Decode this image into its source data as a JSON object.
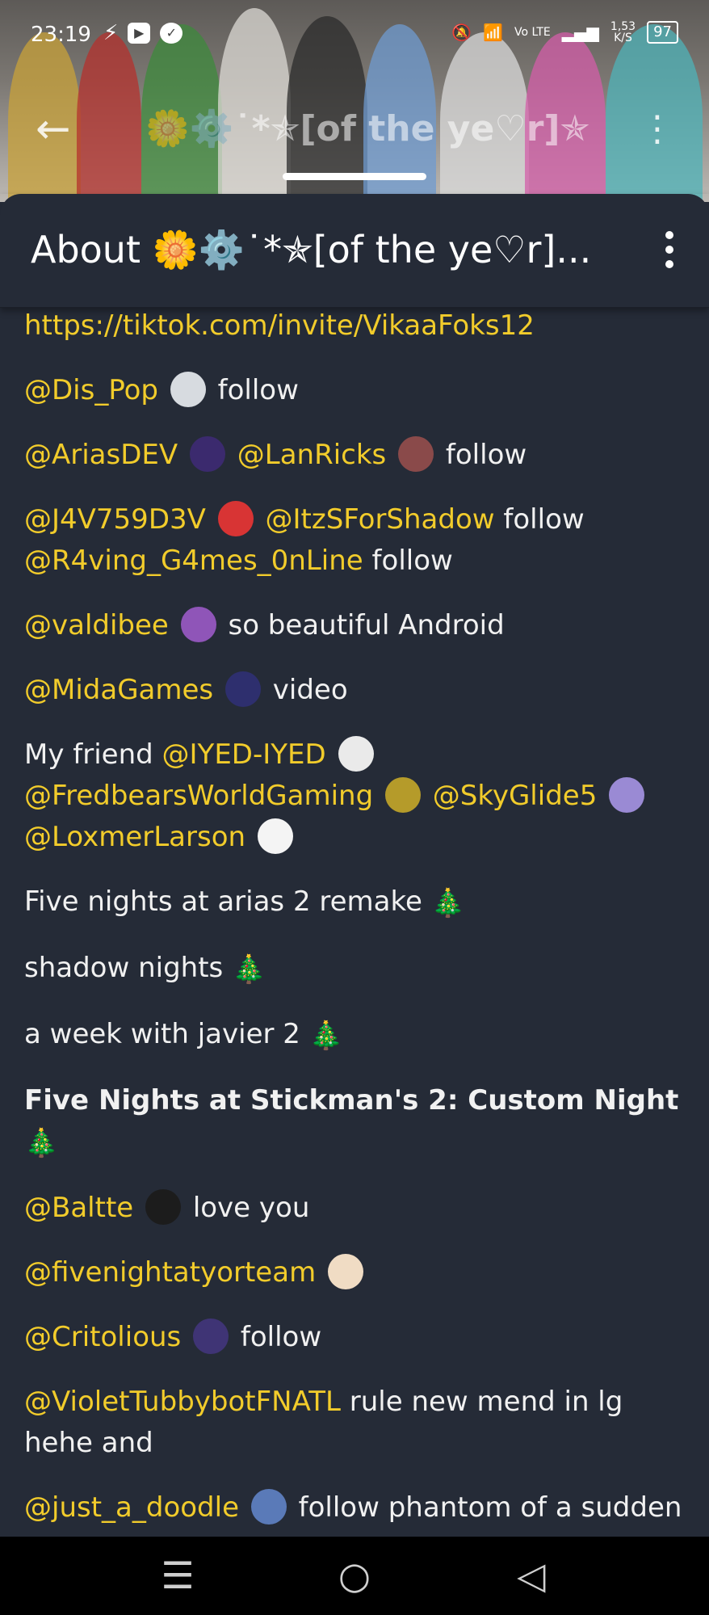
{
  "status_bar": {
    "time": "23:19",
    "network_speed_value": "1,53",
    "network_speed_unit": "K/S",
    "network_type": "Vo LTE",
    "battery": "97"
  },
  "banner": {
    "title": "🌼⚙️˙*✯[of the ye♡r]✯"
  },
  "sheet": {
    "title": "About 🌼⚙️˙*✯[of the ye♡r]..."
  },
  "content": {
    "link": "https://tiktok.com/invite/VikaaFoks12",
    "p1_mention": "@Dis_Pop",
    "p1_text": "follow",
    "p2_mention1": "@AriasDEV",
    "p2_mention2": "@LanRicks",
    "p2_text": "follow",
    "p3_mention1": "@J4V759D3V",
    "p3_mention2": "@ItzSForShadow",
    "p3_text1": "follow",
    "p3_mention3": "@R4ving_G4mes_0nLine",
    "p3_text2": "follow",
    "p4_mention": "@valdibee",
    "p4_text": "so beautiful Android",
    "p5_mention": "@MidaGames",
    "p5_text": "video",
    "p6_text": "My friend",
    "p6_mention1": "@IYED-IYED",
    "p6_mention2": "@FredbearsWorldGaming",
    "p6_mention3": "@SkyGlide5",
    "p6_mention4": "@LoxmerLarson",
    "p7_text": "Five nights at arias 2 remake",
    "p8_text": "shadow nights",
    "p9_text": "a week with javier 2",
    "p10_text": "Five Nights at Stickman's 2: Custom Night",
    "p11_mention": "@Baltte",
    "p11_text": "love you",
    "p12_mention": "@fivenightatyorteam",
    "p13_mention": "@Critolious",
    "p13_text": "follow",
    "p14_mention": "@VioletTubbybotFNATL",
    "p14_text": "rule new mend in lg hehe and",
    "p15_mention": "@just_a_doodle",
    "p15_text": "follow phantom of a sudden the",
    "tree_emoji": "🎄"
  }
}
